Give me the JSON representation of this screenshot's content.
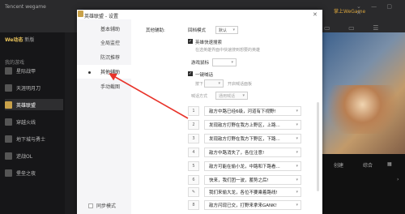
{
  "client": {
    "brand": "Tencent wegame",
    "user_label": "掌上WeGame",
    "user_sub": "",
    "controls": "⌄ — ▢ ✕",
    "header_icons": "▭ ▭ ☰",
    "we_block_title": "We动态",
    "we_block_badge": "新版",
    "my_games_label": "我的游戏",
    "games": [
      {
        "label": "星际战甲"
      },
      {
        "label": "天涯明月刀"
      },
      {
        "label": "英雄联盟"
      },
      {
        "label": "穿越火线"
      },
      {
        "label": "地下城与勇士"
      },
      {
        "label": "逆战OL"
      },
      {
        "label": "堡垒之夜"
      }
    ],
    "side_a": "创建",
    "side_b": "综合",
    "side_c": "▦",
    "side_d": "›"
  },
  "dialog": {
    "title": "英雄联盟 - 设置",
    "close": "✕",
    "nav": [
      {
        "label": "基本辅助"
      },
      {
        "label": "全局监控"
      },
      {
        "label": "防沉推荐"
      },
      {
        "label": "其他辅助"
      },
      {
        "label": "手动截图"
      }
    ],
    "bottom_label": "同步模式",
    "section_label": "其他辅助:",
    "rollback_label": "回档模式",
    "rollback_value": "默认",
    "fast_search_label": "英雄快速搜索",
    "fast_search_hint": "在选英雄界面中快速搜到想要的英雄",
    "hotkey_label": "游戏鼠标",
    "hotkey_value": "",
    "quick_msg_label": "一键喊话",
    "quick_msg_hint": "按下",
    "quick_msg_key": "",
    "quick_msg_suffix": "开启喊话面板",
    "mode_label": "喊话方式",
    "mode_value": "通用喊话",
    "messages": [
      {
        "num": "1",
        "text": "敌方中路已经6级，河道有下视野!"
      },
      {
        "num": "2",
        "text": "发现敌方打野在我方上野区，上路..."
      },
      {
        "num": "3",
        "text": "发现敌方打野在我方下野区，下路..."
      },
      {
        "num": "4",
        "text": "敌方中路消失了，各位注意!"
      },
      {
        "num": "5",
        "text": "敌方可能在偷小龙，中路和下路看..."
      },
      {
        "num": "6",
        "text": "快来，我们团一波，蓄势之后!"
      },
      {
        "num": "✎",
        "text": "我们来偷大龙，各位不要乘着路线!"
      },
      {
        "num": "8",
        "text": "敌方闪现已交，打野来拿来GANK!"
      }
    ]
  }
}
